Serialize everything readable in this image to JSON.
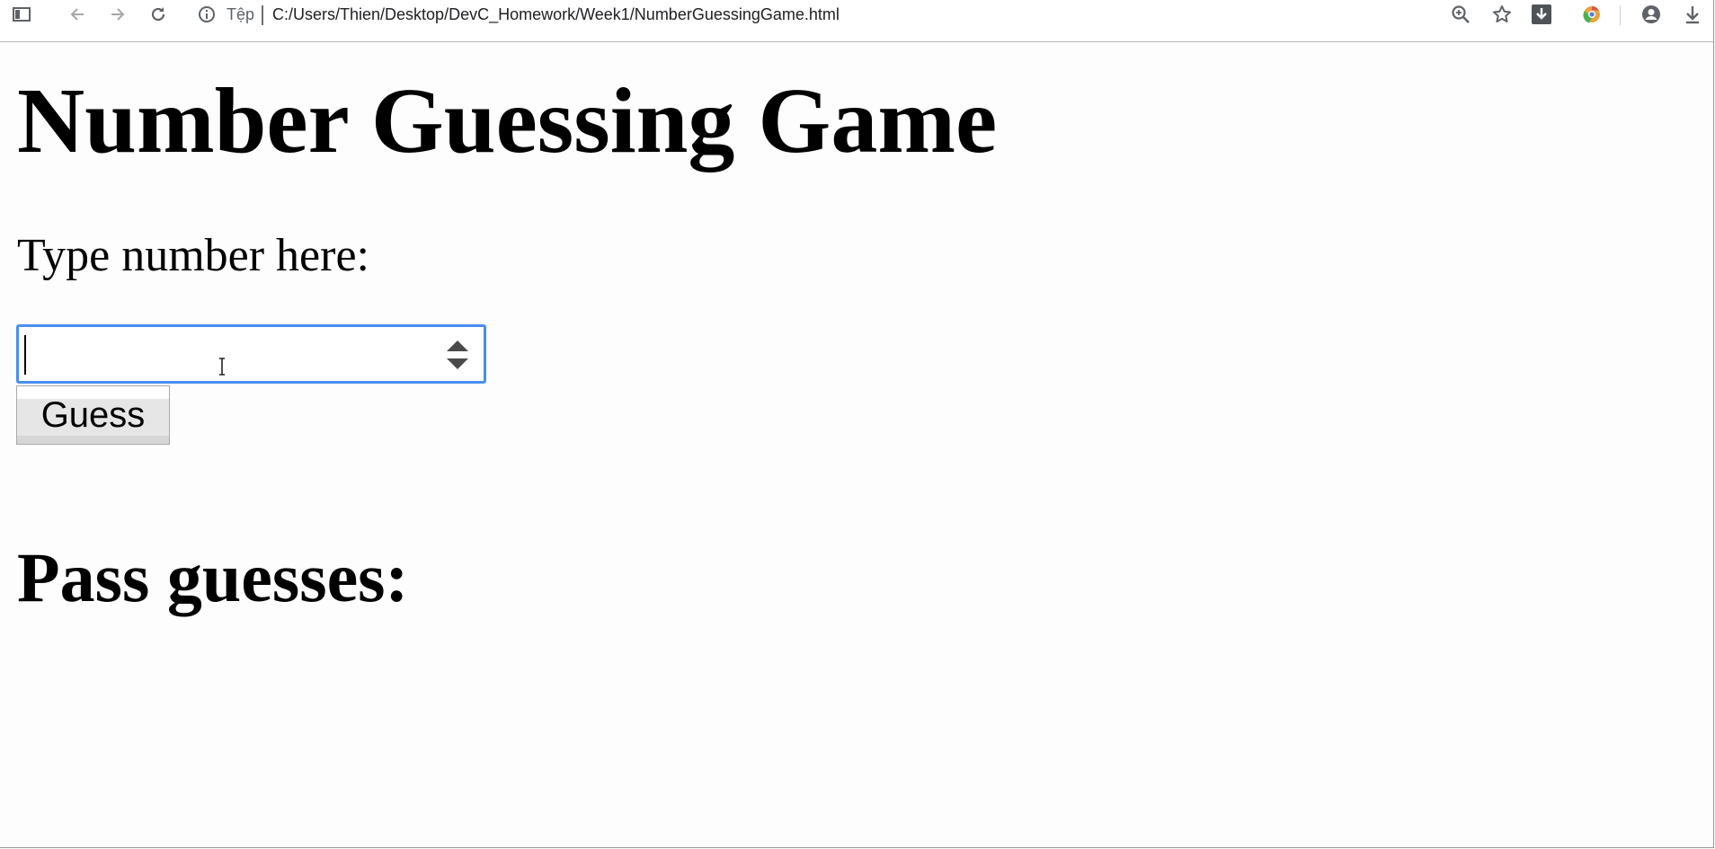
{
  "browser": {
    "site_label": "Tệp",
    "url": "C:/Users/Thien/Desktop/DevC_Homework/Week1/NumberGuessingGame.html",
    "icons": [
      "sidebar-icon",
      "back-icon",
      "forward-icon",
      "reload-icon",
      "info-icon",
      "zoom-icon",
      "star-icon",
      "download-extension-icon",
      "chrome-extension-icon",
      "account-icon",
      "downloads-icon"
    ]
  },
  "page": {
    "title": "Number Guessing Game",
    "prompt": "Type number here:",
    "guess_input_value": "",
    "guess_button": "Guess",
    "pass_heading": "Pass guesses:"
  },
  "colors": {
    "focus_ring": "#4a8ef0"
  }
}
